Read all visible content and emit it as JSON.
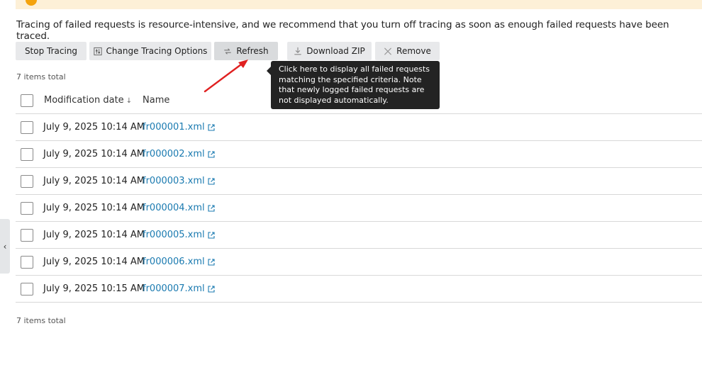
{
  "page": {
    "intro": "Tracing of failed requests is resource-intensive, and we recommend that you turn off tracing as soon as enough failed requests have been traced."
  },
  "toolbar": {
    "stop_tracing": "Stop Tracing",
    "change_options": "Change Tracing Options",
    "refresh": "Refresh",
    "download_zip": "Download ZIP",
    "remove": "Remove"
  },
  "tooltip": {
    "text": "Click here to display all failed requests matching the specified criteria. Note that newly logged failed requests are not displayed automatically."
  },
  "summary": {
    "top_count": "7 items total",
    "bottom_count": "7 items total"
  },
  "table": {
    "headers": {
      "date": "Modification date",
      "sort_indicator": "↓",
      "name": "Name"
    },
    "rows": [
      {
        "date": "July 9, 2025 10:14 AM",
        "name": "fr000001.xml"
      },
      {
        "date": "July 9, 2025 10:14 AM",
        "name": "fr000002.xml"
      },
      {
        "date": "July 9, 2025 10:14 AM",
        "name": "fr000003.xml"
      },
      {
        "date": "July 9, 2025 10:14 AM",
        "name": "fr000004.xml"
      },
      {
        "date": "July 9, 2025 10:14 AM",
        "name": "fr000005.xml"
      },
      {
        "date": "July 9, 2025 10:14 AM",
        "name": "fr000006.xml"
      },
      {
        "date": "July 9, 2025 10:15 AM",
        "name": "fr000007.xml"
      }
    ]
  },
  "colors": {
    "link": "#1a7ab0",
    "button_bg": "#e8e9eb",
    "tooltip_bg": "#232323",
    "annotation_arrow": "#e02020",
    "warning_banner": "#fdf0d7"
  },
  "icons": {
    "side_toggle": "‹"
  }
}
